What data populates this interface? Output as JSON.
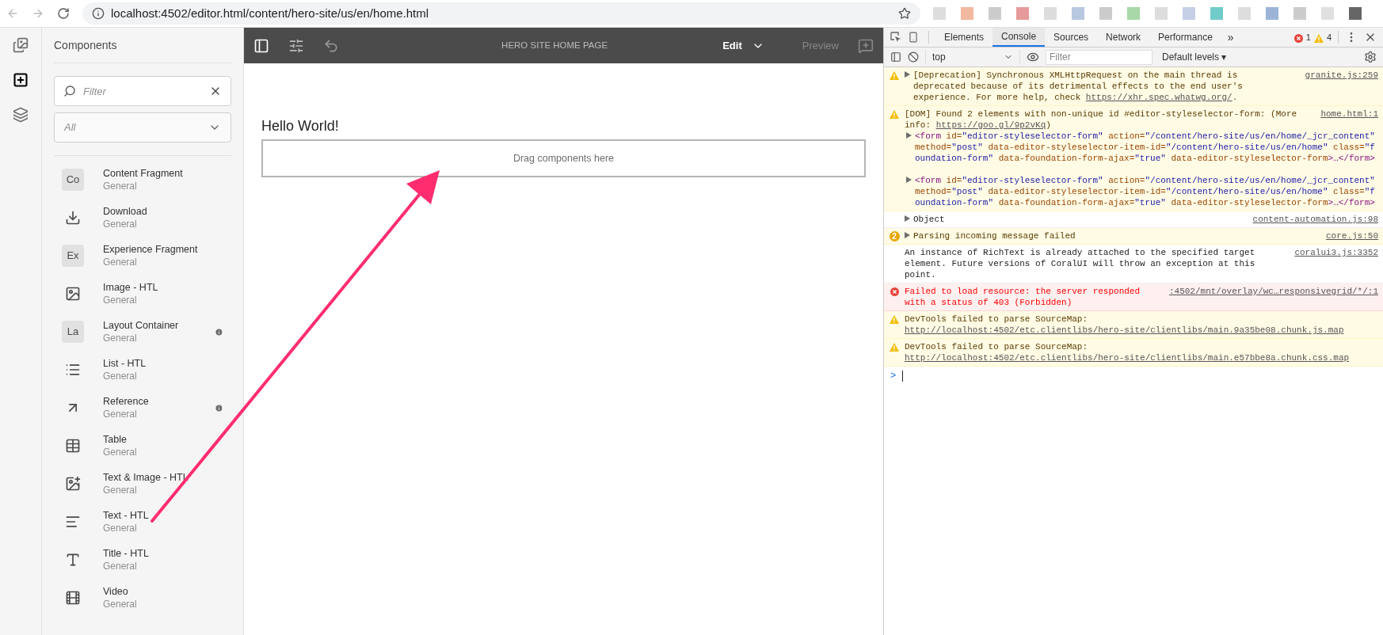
{
  "browser": {
    "url": "localhost:4502/editor.html/content/hero-site/us/en/home.html"
  },
  "rail": [
    {
      "kind": "assets",
      "selected": false
    },
    {
      "kind": "components",
      "selected": true
    },
    {
      "kind": "layers",
      "selected": false
    }
  ],
  "components_panel": {
    "title": "Components",
    "filter": {
      "placeholder": "Filter"
    },
    "group_select": {
      "placeholder": "All"
    },
    "items": [
      {
        "name": "Content Fragment",
        "group": "General",
        "kind": "badge",
        "abbr": "Co",
        "info": false
      },
      {
        "name": "Download",
        "group": "General",
        "kind": "download",
        "info": false
      },
      {
        "name": "Experience Fragment",
        "group": "General",
        "kind": "badge",
        "abbr": "Ex",
        "info": false
      },
      {
        "name": "Image - HTL",
        "group": "General",
        "kind": "image",
        "info": false
      },
      {
        "name": "Layout Container",
        "group": "General",
        "kind": "badge",
        "abbr": "La",
        "info": true
      },
      {
        "name": "List - HTL",
        "group": "General",
        "kind": "list",
        "info": false
      },
      {
        "name": "Reference",
        "group": "General",
        "kind": "reference",
        "info": true
      },
      {
        "name": "Table",
        "group": "General",
        "kind": "table",
        "info": false
      },
      {
        "name": "Text & Image - HTL",
        "group": "General",
        "kind": "text-image",
        "info": false
      },
      {
        "name": "Text - HTL",
        "group": "General",
        "kind": "text",
        "info": false
      },
      {
        "name": "Title - HTL",
        "group": "General",
        "kind": "title",
        "info": false
      },
      {
        "name": "Video",
        "group": "General",
        "kind": "video",
        "info": false
      }
    ]
  },
  "editor": {
    "page_title": "HERO SITE HOME PAGE",
    "mode": "Edit",
    "preview": "Preview",
    "preview_disabled": true,
    "heading": "Hello World!",
    "drop_zone": "Drag components here"
  },
  "devtools": {
    "tabs": [
      {
        "label": "Elements",
        "selected": false
      },
      {
        "label": "Console",
        "selected": true
      },
      {
        "label": "Sources",
        "selected": false
      },
      {
        "label": "Network",
        "selected": false
      },
      {
        "label": "Performance",
        "selected": false
      }
    ],
    "more": "»",
    "error_count": "1",
    "warning_count": "4",
    "context": "top",
    "filter": {
      "placeholder": "Filter"
    },
    "levels": "Default levels ▾",
    "messages": [
      {
        "kind": "warning",
        "expandable": true,
        "text": "[Deprecation] Synchronous XMLHttpRequest on the main thread is deprecated because of its detrimental effects to the end user's experience. For more help, check",
        "link": "https://xhr.spec.whatwg.org/",
        "after": ".",
        "source": "granite.js:259"
      },
      {
        "kind": "warning",
        "expandable": false,
        "text": "[DOM] Found 2 elements with non-unique id #editor-styleselector-form: (More info:",
        "link": "https://goo.gl/9p2vKq",
        "after": ")",
        "source": "home.html:1",
        "elements": [
          [
            {
              "kind": "tag",
              "text": "<form"
            },
            {
              "kind": "attr",
              "text": " id="
            },
            {
              "kind": "value",
              "text": "\"editor-styleselector-form\""
            },
            {
              "kind": "attr",
              "text": " action="
            },
            {
              "kind": "value",
              "text": "\"/content/hero-site/us/en/home/_jcr_content\""
            },
            {
              "kind": "attr",
              "text": " method="
            },
            {
              "kind": "value",
              "text": "\"post\""
            },
            {
              "kind": "attr",
              "text": " data-editor-styleselector-item-id="
            },
            {
              "kind": "value",
              "text": "\"/content/hero-site/us/en/home\""
            },
            {
              "kind": "attr",
              "text": " class="
            },
            {
              "kind": "value",
              "text": "\"foundation-form\""
            },
            {
              "kind": "attr",
              "text": " data-foundation-form-ajax="
            },
            {
              "kind": "value",
              "text": "\"true\""
            },
            {
              "kind": "attr",
              "text": " data-editor-styleselector-form"
            },
            {
              "kind": "tag",
              "text": ">…</form>"
            }
          ],
          [
            {
              "kind": "tag",
              "text": "<form"
            },
            {
              "kind": "attr",
              "text": " id="
            },
            {
              "kind": "value",
              "text": "\"editor-styleselector-form\""
            },
            {
              "kind": "attr",
              "text": " action="
            },
            {
              "kind": "value",
              "text": "\"/content/hero-site/us/en/home/_jcr_content\""
            },
            {
              "kind": "attr",
              "text": " method="
            },
            {
              "kind": "value",
              "text": "\"post\""
            },
            {
              "kind": "attr",
              "text": " data-editor-styleselector-item-id="
            },
            {
              "kind": "value",
              "text": "\"/content/hero-site/us/en/home\""
            },
            {
              "kind": "attr",
              "text": " class="
            },
            {
              "kind": "value",
              "text": "\"foundation-form\""
            },
            {
              "kind": "attr",
              "text": " data-foundation-form-ajax="
            },
            {
              "kind": "value",
              "text": "\"true\""
            },
            {
              "kind": "attr",
              "text": " data-editor-styleselector-form"
            },
            {
              "kind": "tag",
              "text": ">…</form>"
            }
          ]
        ]
      },
      {
        "kind": "info",
        "expandable": true,
        "text": "Object",
        "source": "content-automation.js:98"
      },
      {
        "kind": "warning",
        "expandable": true,
        "count": "2",
        "text": "Parsing incoming message failed",
        "source": "core.js:50"
      },
      {
        "kind": "info",
        "expandable": false,
        "text": "An instance of RichText is already attached to the specified target element. Future versions of CoralUI will throw an exception at this point.",
        "source": "coralui3.js:3352"
      },
      {
        "kind": "error",
        "expandable": false,
        "text": "Failed to load resource: the server responded with a status of 403 (Forbidden)",
        "source": ":4502/mnt/overlay/wc…responsivegrid/*/:1"
      },
      {
        "kind": "warning",
        "expandable": false,
        "text": "DevTools failed to parse SourceMap:",
        "link": "http://localhost:4502/etc.clientlibs/hero-site/clientlibs/main.9a35be08.chunk.js.map"
      },
      {
        "kind": "warning",
        "expandable": false,
        "text": "DevTools failed to parse SourceMap:",
        "link": "http://localhost:4502/etc.clientlibs/hero-site/clientlibs/main.e57bbe8a.chunk.css.map"
      }
    ],
    "prompt": ">"
  }
}
